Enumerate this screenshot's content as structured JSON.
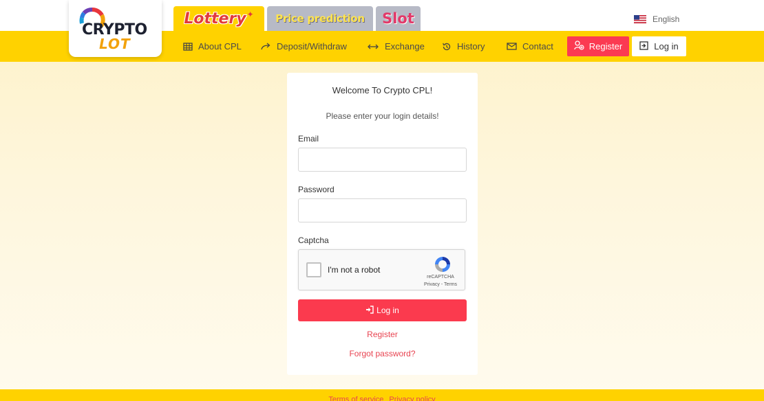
{
  "brand": {
    "logo_line1": "CRYPTO",
    "logo_line2": "LOT",
    "colors": {
      "primary_yellow": "#ffd200",
      "accent_red": "#fb3a52",
      "tab_gray": "#b7bac6"
    }
  },
  "game_tabs": [
    {
      "label": "Lottery",
      "active": true
    },
    {
      "label": "Price prediction",
      "active": false
    },
    {
      "label": "Slot",
      "active": false
    }
  ],
  "language": {
    "label": "English",
    "icon": "us-flag-icon"
  },
  "nav": {
    "items": [
      {
        "label": "About CPL",
        "icon": "building-icon"
      },
      {
        "label": "Deposit/Withdraw",
        "icon": "arrow-redo-icon"
      },
      {
        "label": "Exchange",
        "icon": "arrows-horizontal-icon"
      },
      {
        "label": "History",
        "icon": "history-icon"
      },
      {
        "label": "Contact",
        "icon": "mail-icon"
      }
    ],
    "register_label": "Register",
    "login_label": "Log in"
  },
  "login_form": {
    "welcome": "Welcome To Crypto CPL!",
    "subtitle": "Please enter your login details!",
    "email_label": "Email",
    "email_value": "",
    "password_label": "Password",
    "password_value": "",
    "captcha_label": "Captcha",
    "captcha": {
      "checkbox_text": "I'm not a robot",
      "brand": "reCAPTCHA",
      "links": "Privacy - Terms"
    },
    "submit_label": "Log in",
    "register_link": "Register",
    "forgot_link": "Forgot password?"
  },
  "footer": {
    "terms": "Terms of service",
    "privacy": "Privacy policy"
  }
}
